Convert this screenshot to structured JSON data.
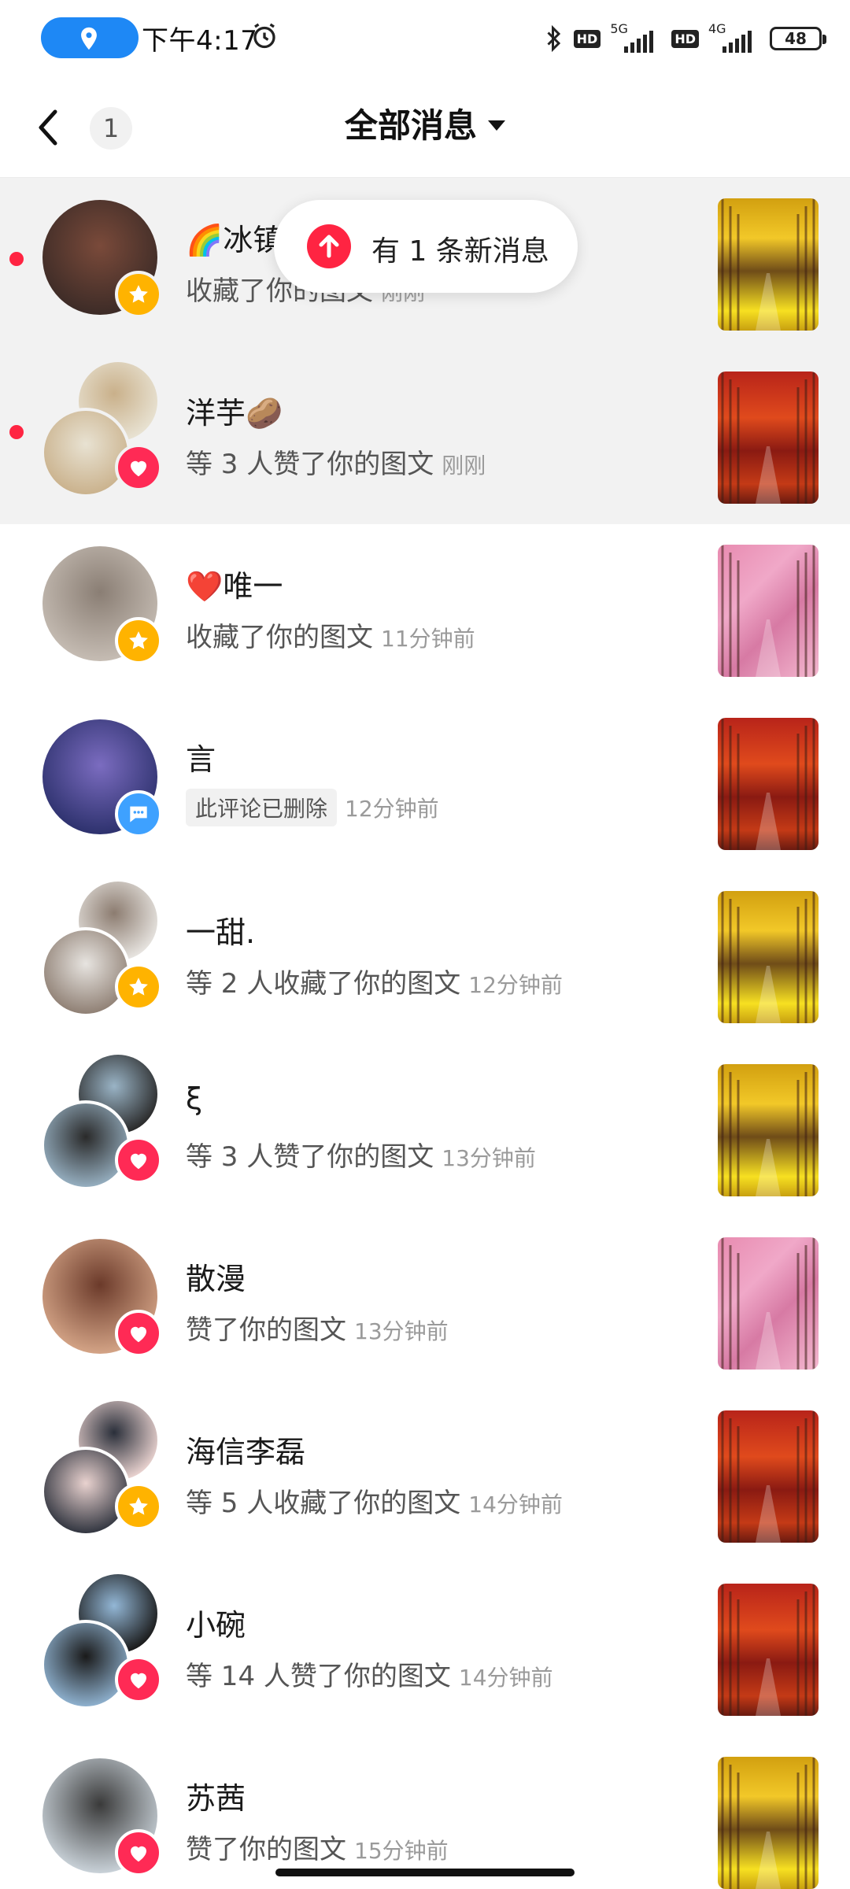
{
  "status_bar": {
    "time": "下午4:17",
    "network_1": "5G",
    "network_2": "4G",
    "hd_label": "HD",
    "battery": "48"
  },
  "header": {
    "unread_count": "1",
    "title": "全部消息"
  },
  "toast": {
    "text": "有 1 条新消息"
  },
  "messages": [
    {
      "name": "🌈冰镇",
      "desc": "收藏了你的图文",
      "time": "刚刚",
      "action": "star",
      "unread": true,
      "thumb": "gold"
    },
    {
      "name": "洋芋🥔",
      "desc": "等 3 人赞了你的图文",
      "time": "刚刚",
      "action": "heart",
      "unread": true,
      "thumb": "red"
    },
    {
      "name": "❤️唯一",
      "desc": "收藏了你的图文",
      "time": "11分钟前",
      "action": "star",
      "unread": false,
      "thumb": "pink"
    },
    {
      "name": "言",
      "desc": "此评论已删除",
      "time": "12分钟前",
      "action": "comment",
      "unread": false,
      "thumb": "red"
    },
    {
      "name": "一甜.",
      "desc": "等 2 人收藏了你的图文",
      "time": "12分钟前",
      "action": "star",
      "unread": false,
      "thumb": "gold"
    },
    {
      "name": "ξ",
      "desc": "等 3 人赞了你的图文",
      "time": "13分钟前",
      "action": "heart",
      "unread": false,
      "thumb": "gold"
    },
    {
      "name": "散漫",
      "desc": "赞了你的图文",
      "time": "13分钟前",
      "action": "heart",
      "unread": false,
      "thumb": "pink"
    },
    {
      "name": "海信李磊",
      "desc": "等 5 人收藏了你的图文",
      "time": "14分钟前",
      "action": "star",
      "unread": false,
      "thumb": "red"
    },
    {
      "name": "小碗",
      "desc": "等 14 人赞了你的图文",
      "time": "14分钟前",
      "action": "heart",
      "unread": false,
      "thumb": "red"
    },
    {
      "name": "苏茜",
      "desc": "赞了你的图文",
      "time": "15分钟前",
      "action": "heart",
      "unread": false,
      "thumb": "gold"
    }
  ],
  "colors": {
    "accent": "#ff2442",
    "location_pill": "#1e88f5",
    "star": "#ffb300",
    "heart": "#ff2a55",
    "comment": "#3ea1ff"
  }
}
